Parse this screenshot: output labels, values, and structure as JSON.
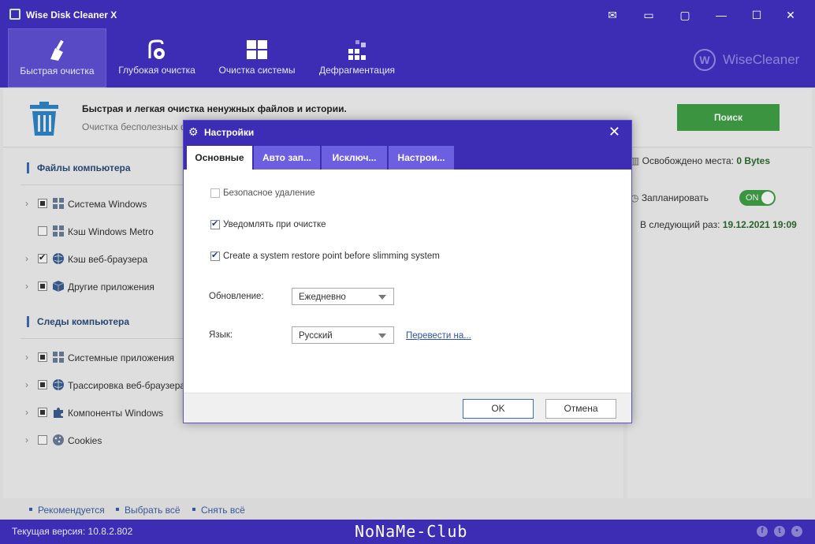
{
  "app": {
    "title": "Wise Disk Cleaner X",
    "brand": "WiseCleaner",
    "brand_letter": "W"
  },
  "titlebar_icons": [
    "mail-icon",
    "feedback-icon",
    "skin-icon",
    "minimize-icon",
    "maximize-icon",
    "close-icon"
  ],
  "toolbar": {
    "tools": [
      {
        "label": "Быстрая очистка",
        "icon": "broom-icon",
        "active": true
      },
      {
        "label": "Глубокая очистка",
        "icon": "vacuum-icon",
        "active": false
      },
      {
        "label": "Очистка системы",
        "icon": "windows-icon",
        "active": false
      },
      {
        "label": "Дефрагментация",
        "icon": "defrag-icon",
        "active": false
      }
    ]
  },
  "header": {
    "title": "Быстрая и легкая очистка ненужных файлов и истории.",
    "subtitle": "Очистка бесполезных фа",
    "scan_button": "Поиск"
  },
  "left": {
    "section1": "Файлы компьютера",
    "section2": "Следы компьютера",
    "items1": [
      {
        "label": "Система Windows",
        "state": "partial",
        "expand": true
      },
      {
        "label": "Кэш Windows Metro",
        "state": "unchecked",
        "expand": false
      },
      {
        "label": "Кэш веб-браузера",
        "state": "checked",
        "expand": true
      },
      {
        "label": "Другие приложения",
        "state": "partial",
        "expand": true
      }
    ],
    "items2": [
      {
        "label": "Системные приложения",
        "state": "partial",
        "expand": true
      },
      {
        "label": "Трассировка веб-браузера",
        "state": "partial",
        "expand": true
      },
      {
        "label": "Компоненты Windows",
        "state": "partial",
        "expand": true
      },
      {
        "label": "Cookies",
        "state": "unchecked",
        "expand": true
      }
    ]
  },
  "right": {
    "freed_label": "Освобождено места:",
    "freed_value": "0 Bytes",
    "schedule_label": "Запланировать",
    "toggle_label": "ON",
    "next_label": "В следующий раз:",
    "next_value": "19.12.2021 19:09"
  },
  "footer": {
    "recommended": "Рекомендуется",
    "select_all": "Выбрать всё",
    "deselect_all": "Снять всё"
  },
  "status": {
    "version": "Текущая версия: 10.8.2.802",
    "watermark": "NoNaMe-Club"
  },
  "dialog": {
    "title": "Настройки",
    "tabs": [
      "Основные",
      "Авто зап...",
      "Исключ...",
      "Настрои..."
    ],
    "options": [
      {
        "label": "Безопасное удаление",
        "checked": false
      },
      {
        "label": "Уведомлять при очистке",
        "checked": true
      },
      {
        "label": "Create a system restore point before slimming system",
        "checked": true
      }
    ],
    "update_label": "Обновление:",
    "update_value": "Ежедневно",
    "language_label": "Язык:",
    "language_value": "Русский",
    "translate_link": "Перевести на...",
    "ok": "OK",
    "cancel": "Отмена"
  }
}
